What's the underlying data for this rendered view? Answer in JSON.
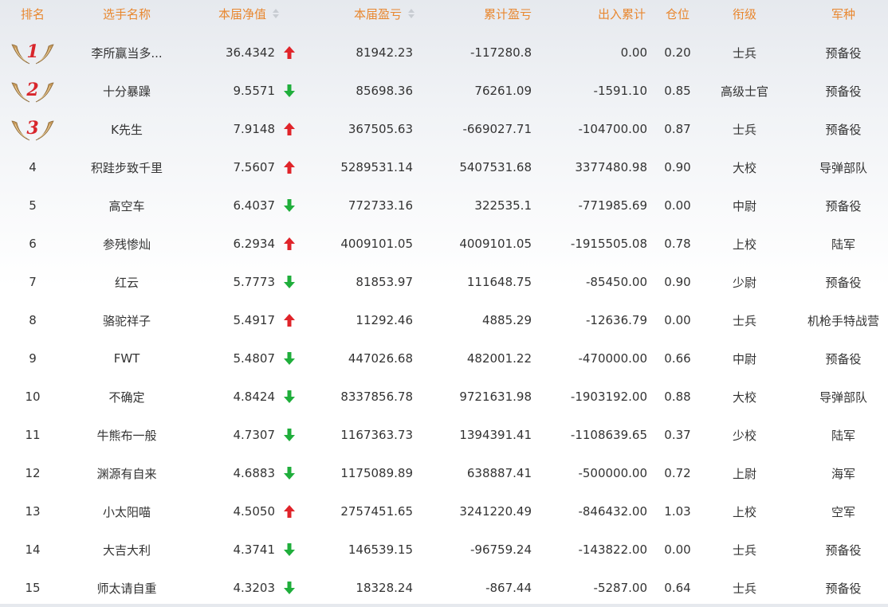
{
  "headers": {
    "rank": "排名",
    "name": "选手名称",
    "nav": "本届净值",
    "pnl": "本届盈亏",
    "cum_pnl": "累计盈亏",
    "cum_flow": "出入累计",
    "position": "仓位",
    "title": "衔级",
    "branch": "军种"
  },
  "colors": {
    "header_text": "#e8872f",
    "up_arrow": "#e0242a",
    "down_arrow": "#1fae3b",
    "medal_number": "#d8262c"
  },
  "rows": [
    {
      "rank": "1",
      "name": "李所赢当多...",
      "nav": "36.4342",
      "trend": "up",
      "pnl": "81942.23",
      "cum_pnl": "-117280.8",
      "cum_flow": "0.00",
      "position": "0.20",
      "title": "士兵",
      "branch": "预备役"
    },
    {
      "rank": "2",
      "name": "十分暴躁",
      "nav": "9.5571",
      "trend": "down",
      "pnl": "85698.36",
      "cum_pnl": "76261.09",
      "cum_flow": "-1591.10",
      "position": "0.85",
      "title": "高级士官",
      "branch": "预备役"
    },
    {
      "rank": "3",
      "name": "K先生",
      "nav": "7.9148",
      "trend": "up",
      "pnl": "367505.63",
      "cum_pnl": "-669027.71",
      "cum_flow": "-104700.00",
      "position": "0.87",
      "title": "士兵",
      "branch": "预备役"
    },
    {
      "rank": "4",
      "name": "积跬步致千里",
      "nav": "7.5607",
      "trend": "up",
      "pnl": "5289531.14",
      "cum_pnl": "5407531.68",
      "cum_flow": "3377480.98",
      "position": "0.90",
      "title": "大校",
      "branch": "导弹部队"
    },
    {
      "rank": "5",
      "name": "高空车",
      "nav": "6.4037",
      "trend": "down",
      "pnl": "772733.16",
      "cum_pnl": "322535.1",
      "cum_flow": "-771985.69",
      "position": "0.00",
      "title": "中尉",
      "branch": "预备役"
    },
    {
      "rank": "6",
      "name": "参残惨灿",
      "nav": "6.2934",
      "trend": "up",
      "pnl": "4009101.05",
      "cum_pnl": "4009101.05",
      "cum_flow": "-1915505.08",
      "position": "0.78",
      "title": "上校",
      "branch": "陆军"
    },
    {
      "rank": "7",
      "name": "红云",
      "nav": "5.7773",
      "trend": "down",
      "pnl": "81853.97",
      "cum_pnl": "111648.75",
      "cum_flow": "-85450.00",
      "position": "0.90",
      "title": "少尉",
      "branch": "预备役"
    },
    {
      "rank": "8",
      "name": "骆驼祥子",
      "nav": "5.4917",
      "trend": "up",
      "pnl": "11292.46",
      "cum_pnl": "4885.29",
      "cum_flow": "-12636.79",
      "position": "0.00",
      "title": "士兵",
      "branch": "机枪手特战营"
    },
    {
      "rank": "9",
      "name": "FWT",
      "nav": "5.4807",
      "trend": "down",
      "pnl": "447026.68",
      "cum_pnl": "482001.22",
      "cum_flow": "-470000.00",
      "position": "0.66",
      "title": "中尉",
      "branch": "预备役"
    },
    {
      "rank": "10",
      "name": "不确定",
      "nav": "4.8424",
      "trend": "down",
      "pnl": "8337856.78",
      "cum_pnl": "9721631.98",
      "cum_flow": "-1903192.00",
      "position": "0.88",
      "title": "大校",
      "branch": "导弹部队"
    },
    {
      "rank": "11",
      "name": "牛熊布一般",
      "nav": "4.7307",
      "trend": "down",
      "pnl": "1167363.73",
      "cum_pnl": "1394391.41",
      "cum_flow": "-1108639.65",
      "position": "0.37",
      "title": "少校",
      "branch": "陆军"
    },
    {
      "rank": "12",
      "name": "渊源有自来",
      "nav": "4.6883",
      "trend": "down",
      "pnl": "1175089.89",
      "cum_pnl": "638887.41",
      "cum_flow": "-500000.00",
      "position": "0.72",
      "title": "上尉",
      "branch": "海军"
    },
    {
      "rank": "13",
      "name": "小太阳喵",
      "nav": "4.5050",
      "trend": "up",
      "pnl": "2757451.65",
      "cum_pnl": "3241220.49",
      "cum_flow": "-846432.00",
      "position": "1.03",
      "title": "上校",
      "branch": "空军"
    },
    {
      "rank": "14",
      "name": "大吉大利",
      "nav": "4.3741",
      "trend": "down",
      "pnl": "146539.15",
      "cum_pnl": "-96759.24",
      "cum_flow": "-143822.00",
      "position": "0.00",
      "title": "士兵",
      "branch": "预备役"
    },
    {
      "rank": "15",
      "name": "师太请自重",
      "nav": "4.3203",
      "trend": "down",
      "pnl": "18328.24",
      "cum_pnl": "-867.44",
      "cum_flow": "-5287.00",
      "position": "0.64",
      "title": "士兵",
      "branch": "预备役"
    }
  ]
}
